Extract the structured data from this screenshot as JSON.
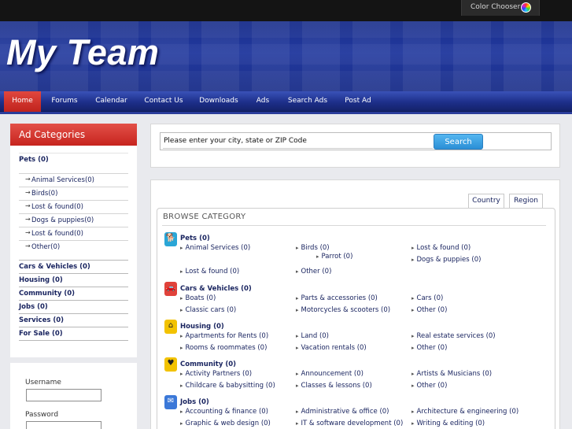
{
  "topbar": {
    "color_chooser_label": "Color Chooser"
  },
  "header": {
    "site_title": "My Team"
  },
  "nav": {
    "items": [
      {
        "label": "Home",
        "active": true
      },
      {
        "label": "Forums"
      },
      {
        "label": "Calendar"
      },
      {
        "label": "Contact Us"
      },
      {
        "label": "Downloads"
      },
      {
        "label": "Ads"
      },
      {
        "label": "Search Ads"
      },
      {
        "label": "Post Ad"
      }
    ]
  },
  "sidebar": {
    "title": "Ad Categories",
    "pets": "Pets (0)",
    "pet_subs": [
      "Animal Services(0)",
      "Birds(0)",
      "Lost & found(0)",
      "Dogs & puppies(0)",
      "Lost & found(0)",
      "Other(0)"
    ],
    "categories": [
      "Cars & Vehicles (0)",
      "Housing (0)",
      "Community (0)",
      "Jobs (0)",
      "Services (0)",
      "For Sale (0)"
    ]
  },
  "login": {
    "username_label": "Username",
    "password_label": "Password"
  },
  "search": {
    "input_value": "Please enter your city, state or ZIP Code",
    "button_label": "Search"
  },
  "browse": {
    "tabs": [
      "Country",
      "Region"
    ],
    "title": "BROWSE CATEGORY",
    "groups": [
      {
        "name": "Pets (0)",
        "icon": "dog-icon",
        "color": "#2aa6d6",
        "subs": [
          "Animal Services (0)",
          "Birds (0)",
          "Lost & found (0)",
          "Parrot (0)",
          "Dogs & puppies (0)",
          "Lost & found (0)",
          "Other (0)"
        ]
      },
      {
        "name": "Cars & Vehicles (0)",
        "icon": "car-icon",
        "color": "#e0423a",
        "subs": [
          "Boats (0)",
          "Parts & accessories (0)",
          "Cars (0)",
          "Classic cars (0)",
          "Motorcycles & scooters (0)",
          "Other (0)"
        ]
      },
      {
        "name": "Housing (0)",
        "icon": "house-icon",
        "color": "#f2c200",
        "subs": [
          "Apartments for Rents (0)",
          "Land (0)",
          "Real estate services (0)",
          "Rooms & roommates (0)",
          "Vacation rentals (0)",
          "Other (0)"
        ]
      },
      {
        "name": "Community (0)",
        "icon": "people-icon",
        "color": "#f2c200",
        "subs": [
          "Activity Partners (0)",
          "Announcement (0)",
          "Artists & Musicians (0)",
          "Childcare & babysitting (0)",
          "Classes & lessons (0)",
          "Other (0)"
        ]
      },
      {
        "name": "Jobs (0)",
        "icon": "briefcase-icon",
        "color": "#3b78d8",
        "subs": [
          "Accounting & finance (0)",
          "Administrative & office (0)",
          "Architecture & engineering (0)",
          "Graphic & web design (0)",
          "IT & software development (0)",
          "Writing & editing (0)"
        ]
      }
    ]
  }
}
